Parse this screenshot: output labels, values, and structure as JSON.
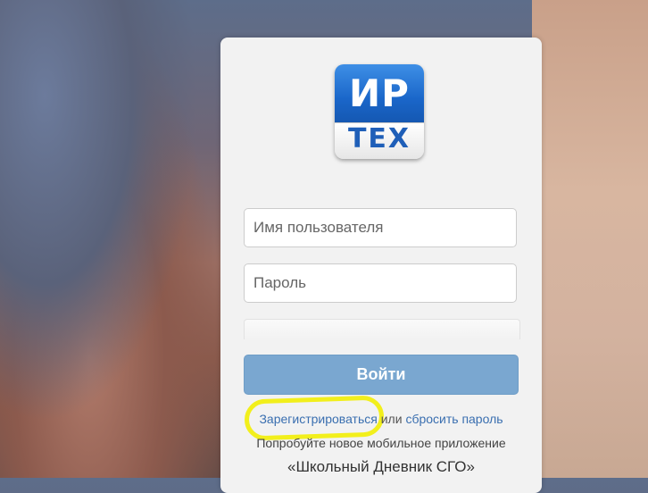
{
  "logo": {
    "top_text": "ИР",
    "bottom_text": "ТЕХ"
  },
  "form": {
    "username_placeholder": "Имя пользователя",
    "password_placeholder": "Пароль",
    "login_label": "Войти"
  },
  "links": {
    "register": "Зарегистрироваться",
    "or": " или ",
    "reset_password": "сбросить пароль"
  },
  "promo": {
    "text": "Попробуйте новое мобильное приложение",
    "app_name": "«Школьный Дневник СГО»"
  },
  "colors": {
    "login_button": "#7aa7d0",
    "link": "#3a6fb0",
    "highlight": "#f2ef1c",
    "logo_blue": "#1a66c9"
  }
}
